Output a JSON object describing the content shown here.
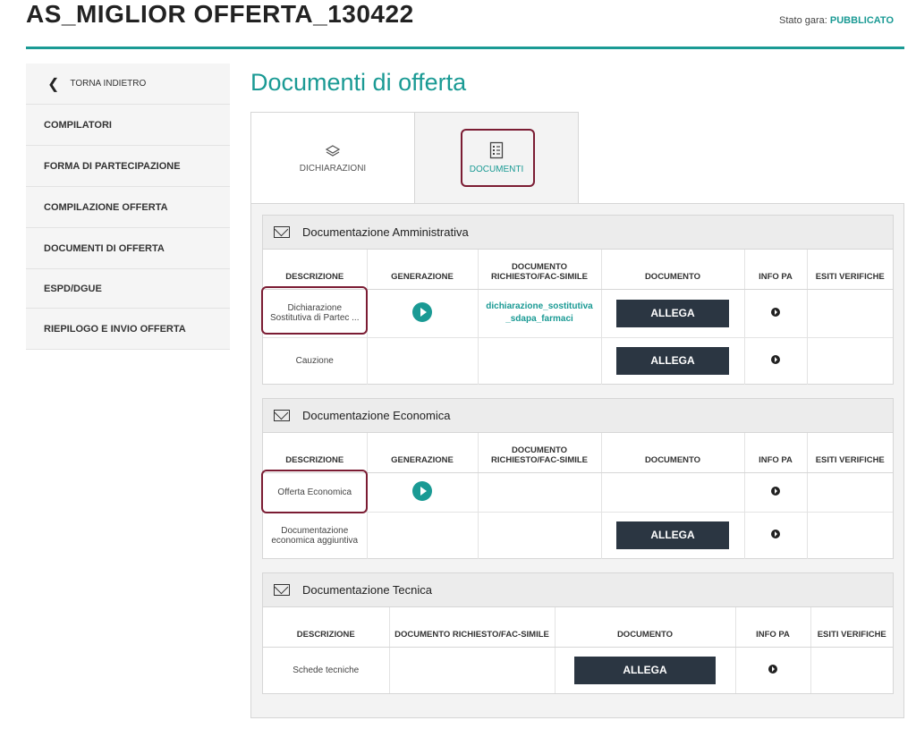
{
  "header": {
    "title": "AS_MIGLIOR OFFERTA_130422",
    "status_label": "Stato gara:",
    "status_value": "PUBBLICATO"
  },
  "sidebar": {
    "back_label": "TORNA INDIETRO",
    "items": [
      {
        "label": "COMPILATORI"
      },
      {
        "label": "FORMA DI PARTECIPAZIONE"
      },
      {
        "label": "COMPILAZIONE OFFERTA"
      },
      {
        "label": "DOCUMENTI DI OFFERTA"
      },
      {
        "label": "ESPD/DGUE"
      },
      {
        "label": "RIEPILOGO E INVIO OFFERTA"
      }
    ]
  },
  "section_title": "Documenti di offerta",
  "tabs": [
    {
      "label": "DICHIARAZIONI",
      "icon": "layers-icon"
    },
    {
      "label": "DOCUMENTI",
      "icon": "document-list-icon"
    }
  ],
  "columns": {
    "descrizione": "DESCRIZIONE",
    "generazione": "GENERAZIONE",
    "documento_richiesto": "DOCUMENTO RICHIESTO/FAC-SIMILE",
    "documento": "DOCUMENTO",
    "info_pa": "INFO PA",
    "esiti": "ESITI VERIFICHE"
  },
  "blocks": {
    "amministrativa": {
      "title": "Documentazione Amministrativa",
      "rows": [
        {
          "descrizione": "Dichiarazione Sostitutiva di Partec ...",
          "doc_link": "dichiarazione_sostitutiva_sdapa_farmaci",
          "allega": "ALLEGA"
        },
        {
          "descrizione": "Cauzione",
          "allega": "ALLEGA"
        }
      ]
    },
    "economica": {
      "title": "Documentazione Economica",
      "rows": [
        {
          "descrizione": "Offerta Economica"
        },
        {
          "descrizione": "Documentazione economica aggiuntiva",
          "allega": "ALLEGA"
        }
      ]
    },
    "tecnica": {
      "title": "Documentazione Tecnica",
      "rows": [
        {
          "descrizione": "Schede tecniche",
          "allega": "ALLEGA"
        }
      ]
    }
  },
  "colors": {
    "accent": "#1a9a94",
    "button": "#2b3642",
    "highlight": "#7b1c33"
  }
}
